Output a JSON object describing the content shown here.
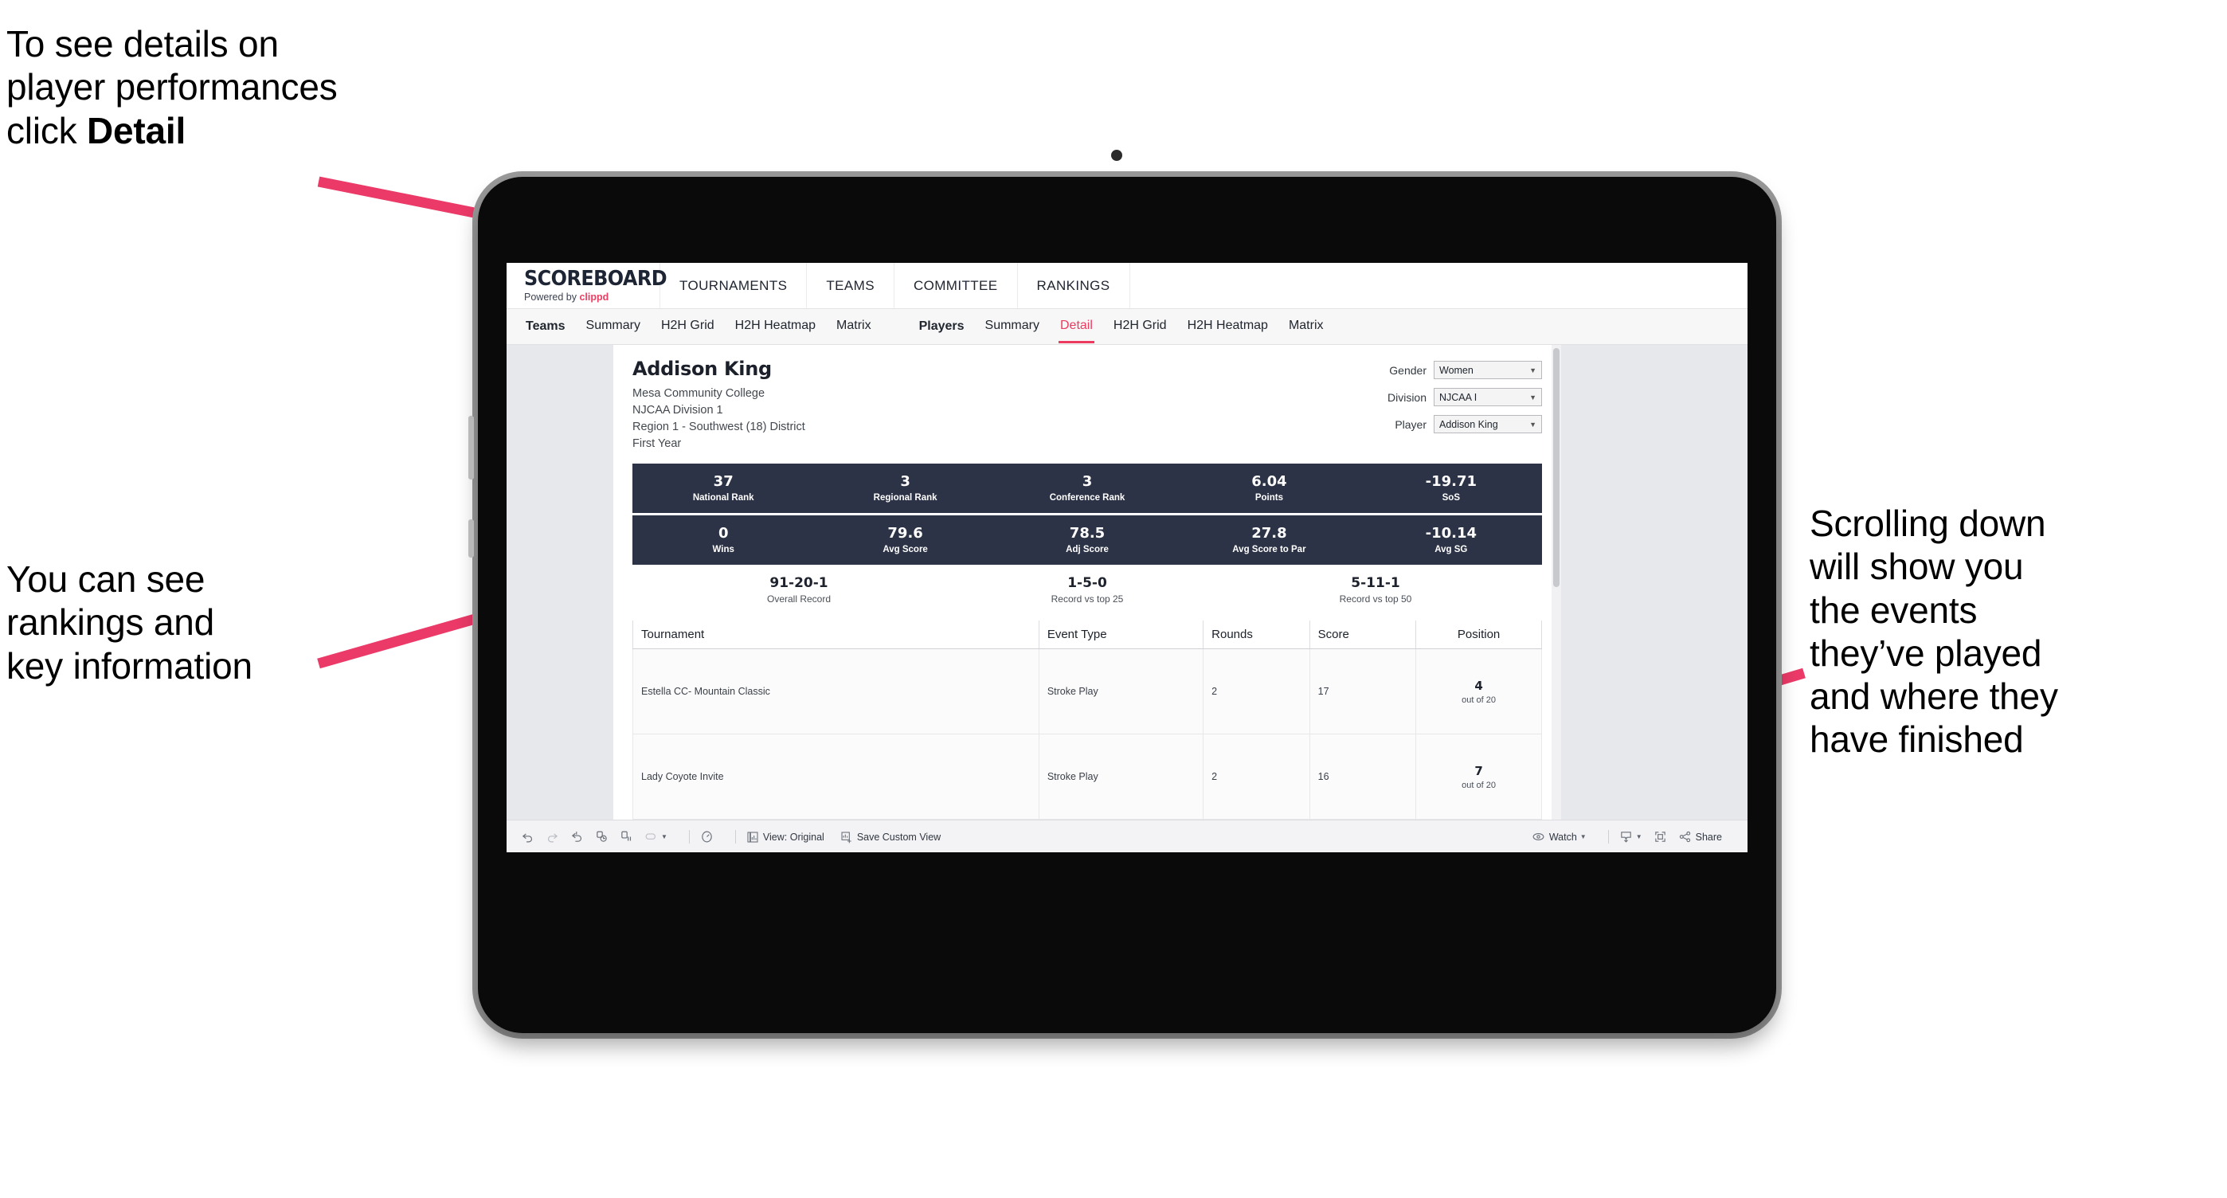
{
  "annotations": {
    "detail": "To see details on\nplayer performances\nclick ",
    "detail_bold": "Detail",
    "rankings": "You can see\nrankings and\nkey information",
    "scrolling": "Scrolling down\nwill show you\nthe events\nthey’ve played\nand where they\nhave finished"
  },
  "colors": {
    "accent_pink": "#ec3b5f",
    "stat_bar": "#2d3346",
    "arrow": "#eb3a68"
  },
  "app": {
    "brand": {
      "title": "SCOREBOARD",
      "powered_prefix": "Powered by ",
      "powered_by": "clippd"
    },
    "top_nav": [
      "TOURNAMENTS",
      "TEAMS",
      "COMMITTEE",
      "RANKINGS"
    ],
    "sub_nav": {
      "teams_group": {
        "header": "Teams",
        "items": [
          "Summary",
          "H2H Grid",
          "H2H Heatmap",
          "Matrix"
        ]
      },
      "players_group": {
        "header": "Players",
        "items": [
          "Summary",
          "Detail",
          "H2H Grid",
          "H2H Heatmap",
          "Matrix"
        ],
        "active": "Detail"
      }
    }
  },
  "player": {
    "name": "Addison King",
    "meta": [
      "Mesa Community College",
      "NJCAA Division 1",
      "Region 1 - Southwest (18) District",
      "First Year"
    ],
    "filters": [
      {
        "label": "Gender",
        "value": "Women"
      },
      {
        "label": "Division",
        "value": "NJCAA I"
      },
      {
        "label": "Player",
        "value": "Addison King"
      }
    ]
  },
  "stats_row_1": [
    {
      "value": "37",
      "label": "National Rank"
    },
    {
      "value": "3",
      "label": "Regional Rank"
    },
    {
      "value": "3",
      "label": "Conference Rank"
    },
    {
      "value": "6.04",
      "label": "Points"
    },
    {
      "value": "-19.71",
      "label": "SoS"
    }
  ],
  "stats_row_2": [
    {
      "value": "0",
      "label": "Wins"
    },
    {
      "value": "79.6",
      "label": "Avg Score"
    },
    {
      "value": "78.5",
      "label": "Adj Score"
    },
    {
      "value": "27.8",
      "label": "Avg Score to Par"
    },
    {
      "value": "-10.14",
      "label": "Avg SG"
    }
  ],
  "records": [
    {
      "value": "91-20-1",
      "label": "Overall Record"
    },
    {
      "value": "1-5-0",
      "label": "Record vs top 25"
    },
    {
      "value": "5-11-1",
      "label": "Record vs top 50"
    }
  ],
  "events_table": {
    "headers": [
      "Tournament",
      "Event Type",
      "Rounds",
      "Score",
      "Position"
    ],
    "rows": [
      {
        "tournament": "Estella CC- Mountain Classic",
        "event_type": "Stroke Play",
        "rounds": "2",
        "score": "17",
        "position": "4",
        "out_of": "out of 20"
      },
      {
        "tournament": "Lady Coyote Invite",
        "event_type": "Stroke Play",
        "rounds": "2",
        "score": "16",
        "position": "7",
        "out_of": "out of 20"
      }
    ]
  },
  "toolbar": {
    "view_label": "View: Original",
    "save_label": "Save Custom View",
    "watch_label": "Watch",
    "share_label": "Share"
  }
}
